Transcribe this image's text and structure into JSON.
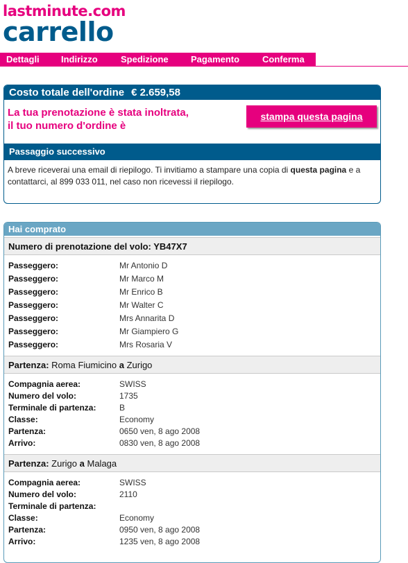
{
  "brand": {
    "site": "lastminute.com",
    "title": "carrello"
  },
  "nav": [
    "Dettagli",
    "Indirizzo",
    "Spedizione",
    "Pagamento",
    "Conferma"
  ],
  "order": {
    "total_label": "Costo totale dell'ordine",
    "total_amount": "€ 2.659,58",
    "confirmation_line1": "La tua prenotazione è stata inoltrata,",
    "confirmation_line2": "il tuo numero d'ordine è",
    "print_button": "stampa questa pagina",
    "next_heading": "Passaggio successivo",
    "next_text_a": "A breve riceverai una email di riepilogo. Ti invitiamo a stampare una copia di ",
    "next_text_bold": "questa pagina",
    "next_text_b": " e a contattarci, al 899 033 011, nel caso non ricevessi il riepilogo."
  },
  "purchase": {
    "heading": "Hai comprato",
    "booking_label": "Numero di prenotazione del volo:",
    "booking_code": "YB47X7",
    "passenger_label": "Passeggero:",
    "passengers": [
      "Mr Antonio D",
      "Mr Marco M",
      "Mr Enrico B",
      "Mr Walter C",
      "Mrs Annarita D",
      "Mr Giampiero G",
      "Mrs Rosaria V"
    ],
    "flights": [
      {
        "from_label": "Partenza:",
        "from": "Roma Fiumicino",
        "to_label": "a",
        "to": "Zurigo",
        "rows": [
          {
            "label": "Compagnia aerea:",
            "value": "SWISS"
          },
          {
            "label": "Numero del volo:",
            "value": "1735"
          },
          {
            "label": "Terminale di partenza:",
            "value": "B"
          },
          {
            "label": "Classe:",
            "value": "Economy"
          },
          {
            "label": "Partenza:",
            "value": "0650 ven, 8 ago 2008"
          },
          {
            "label": "Arrivo:",
            "value": "0830 ven, 8 ago 2008"
          }
        ]
      },
      {
        "from_label": "Partenza:",
        "from": "Zurigo",
        "to_label": "a",
        "to": "Malaga",
        "rows": [
          {
            "label": "Compagnia aerea:",
            "value": "SWISS"
          },
          {
            "label": "Numero del volo:",
            "value": "2110"
          },
          {
            "label": "Terminale di partenza:",
            "value": ""
          },
          {
            "label": "Classe:",
            "value": "Economy"
          },
          {
            "label": "Partenza:",
            "value": "0950 ven, 8 ago 2008"
          },
          {
            "label": "Arrivo:",
            "value": "1235 ven, 8 ago 2008"
          }
        ]
      }
    ]
  },
  "colors": {
    "brand_pink": "#e6007e",
    "brand_blue": "#005b8c",
    "section_blue": "#6aa6c4"
  }
}
